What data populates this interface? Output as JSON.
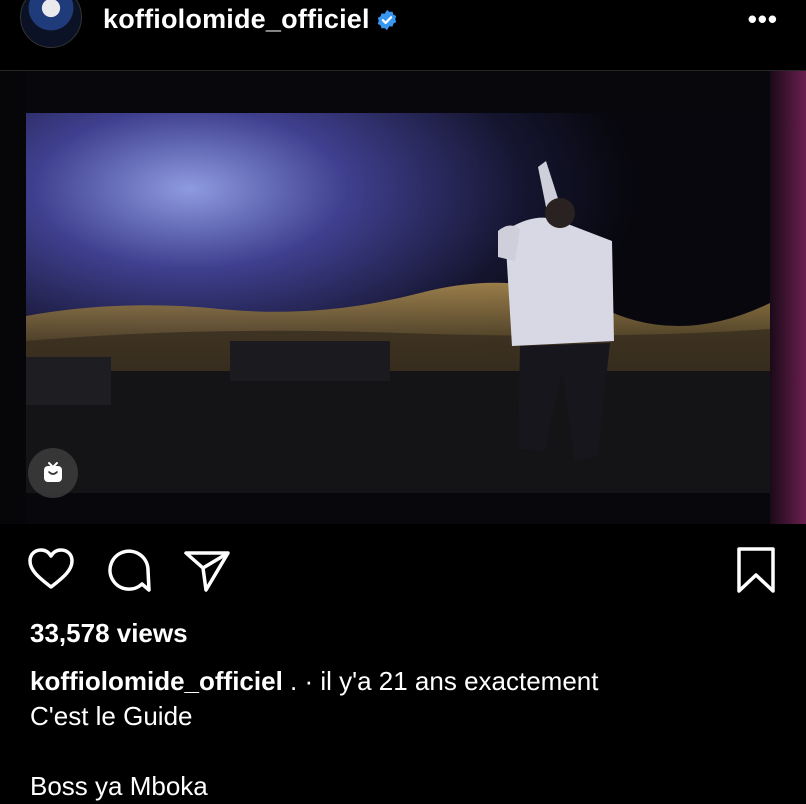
{
  "post": {
    "username": "koffiolomide_officiel",
    "verified": true,
    "more_icon": "more-horizontal-icon",
    "views": "33,578 views",
    "caption": {
      "username": "koffiolomide_officiel",
      "first_line": " . · il y'a 21 ans exactement",
      "lines": [
        "C'est le Guide",
        "",
        "Boss ya Mboka"
      ]
    }
  },
  "icons": {
    "like": "heart-icon",
    "comment": "comment-icon",
    "share": "send-icon",
    "save": "bookmark-icon",
    "reel": "reel-icon"
  },
  "colors": {
    "background": "#000000",
    "text": "#ffffff",
    "verified_badge": "#3897f0"
  }
}
